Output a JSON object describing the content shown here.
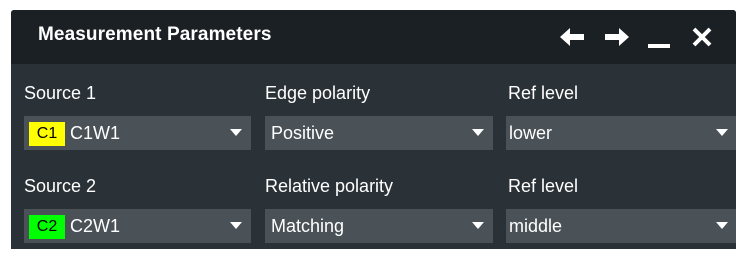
{
  "window": {
    "title": "Measurement Parameters",
    "buttons": {
      "back": "arrow-left-icon",
      "forward": "arrow-right-icon",
      "minimize": "minimize-icon",
      "close": "close-icon"
    }
  },
  "row1": {
    "source_label": "Source 1",
    "source_badge": "C1",
    "source_badge_color": "#ffff00",
    "source_value": "C1W1",
    "polarity_label": "Edge polarity",
    "polarity_value": "Positive",
    "ref_label": "Ref level",
    "ref_value": "lower"
  },
  "row2": {
    "source_label": "Source 2",
    "source_badge": "C2",
    "source_badge_color": "#00ff00",
    "source_value": "C2W1",
    "polarity_label": "Relative polarity",
    "polarity_value": "Matching",
    "ref_label": "Ref level",
    "ref_value": "middle"
  }
}
